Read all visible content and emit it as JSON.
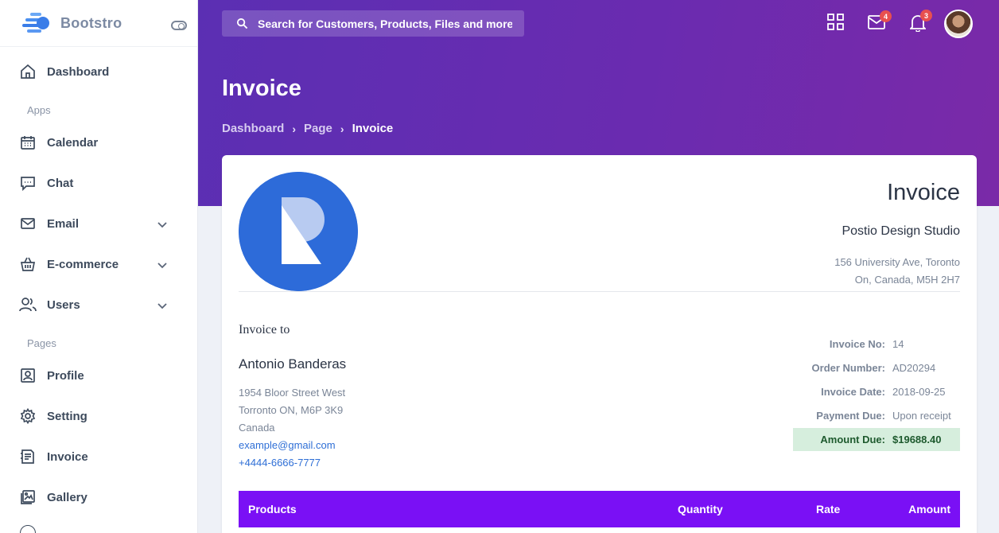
{
  "brand": {
    "name": "Bootstro"
  },
  "sidebar": {
    "items": [
      {
        "label": "Dashboard"
      },
      {
        "label": "Calendar"
      },
      {
        "label": "Chat"
      },
      {
        "label": "Email"
      },
      {
        "label": "E-commerce"
      },
      {
        "label": "Users"
      },
      {
        "label": "Profile"
      },
      {
        "label": "Setting"
      },
      {
        "label": "Invoice"
      },
      {
        "label": "Gallery"
      }
    ],
    "sections": {
      "apps": "Apps",
      "pages": "Pages"
    }
  },
  "header": {
    "search_placeholder": "Search for Customers, Products, Files and more.",
    "mail_badge": "4",
    "bell_badge": "3",
    "page_title": "Invoice",
    "breadcrumb": [
      "Dashboard",
      "Page",
      "Invoice"
    ]
  },
  "invoice": {
    "title": "Invoice",
    "company": "Postio Design Studio",
    "company_address": [
      "156 University Ave, Toronto",
      "On, Canada, M5H 2H7"
    ],
    "to_label": "Invoice to",
    "client_name": "Antonio Banderas",
    "client_address": [
      "1954 Bloor Street West",
      "Torronto ON, M6P 3K9",
      "Canada"
    ],
    "client_email": "example@gmail.com",
    "client_phone": "+4444-6666-7777",
    "meta": [
      {
        "key": "Invoice No:",
        "value": "14"
      },
      {
        "key": "Order Number:",
        "value": "AD20294"
      },
      {
        "key": "Invoice Date:",
        "value": "2018-09-25"
      },
      {
        "key": "Payment Due:",
        "value": "Upon receipt"
      }
    ],
    "amount_due": {
      "key": "Amount Due:",
      "value": "$19688.40"
    },
    "table_headers": [
      "Products",
      "Quantity",
      "Rate",
      "Amount"
    ]
  },
  "colors": {
    "accent": "#7a10f5",
    "header_gradient_start": "#5b2fb3",
    "header_gradient_end": "#7a2aa8",
    "badge": "#e8504f",
    "amount_due_bg": "#d6eedd"
  }
}
